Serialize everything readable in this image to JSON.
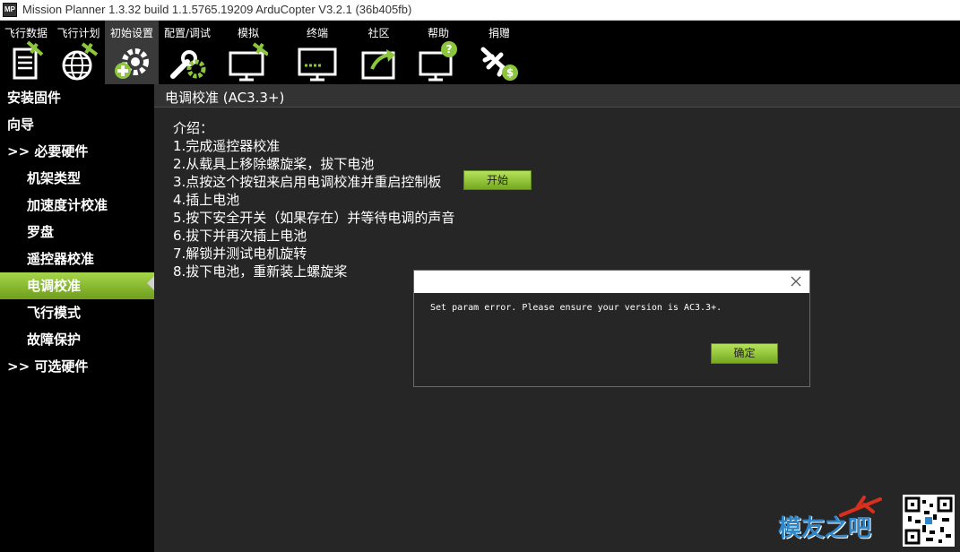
{
  "window": {
    "title": "Mission Planner 1.3.32 build 1.1.5765.19209 ArduCopter V3.2.1 (36b405fb)",
    "logo_text": "MP"
  },
  "toolbar": {
    "items": [
      {
        "label": "飞行数据",
        "icon": "document-icon"
      },
      {
        "label": "飞行计划",
        "icon": "globe-icon"
      },
      {
        "label": "初始设置",
        "icon": "gear-plus-icon"
      },
      {
        "label": "配置/调试",
        "icon": "wrench-gear-icon"
      },
      {
        "label": "模拟",
        "icon": "monitor-plane-icon"
      },
      {
        "label": "终端",
        "icon": "terminal-monitor-icon"
      },
      {
        "label": "社区",
        "icon": "share-arrow-icon"
      },
      {
        "label": "帮助",
        "icon": "help-monitor-icon"
      },
      {
        "label": "捐赠",
        "icon": "plane-dollar-icon"
      }
    ],
    "active_index": 2
  },
  "sidebar": {
    "items": [
      {
        "label": "安装固件",
        "level": "top"
      },
      {
        "label": "向导",
        "level": "top"
      },
      {
        "label": ">> 必要硬件",
        "level": "top"
      },
      {
        "label": "机架类型",
        "level": "sub"
      },
      {
        "label": "加速度计校准",
        "level": "sub"
      },
      {
        "label": "罗盘",
        "level": "sub"
      },
      {
        "label": "遥控器校准",
        "level": "sub"
      },
      {
        "label": "电调校准",
        "level": "sub",
        "selected": true
      },
      {
        "label": "飞行模式",
        "level": "sub"
      },
      {
        "label": "故障保护",
        "level": "sub"
      },
      {
        "label": ">> 可选硬件",
        "level": "top"
      }
    ]
  },
  "main": {
    "title": "电调校准 (AC3.3+)",
    "intro": "介绍：",
    "steps": [
      "1.完成遥控器校准",
      "2.从载具上移除螺旋桨，拔下电池",
      "3.点按这个按钮来启用电调校准并重启控制板",
      "4.插上电池",
      "5.按下安全开关（如果存在）并等待电调的声音",
      "6.拔下并再次插上电池",
      "7.解锁并测试电机旋转",
      "8.拔下电池，重新装上螺旋桨"
    ],
    "start_label": "开始"
  },
  "dialog": {
    "message": "Set param error. Please ensure your version is AC3.3+.",
    "ok_label": "确定"
  },
  "watermark": {
    "text": "模友之吧"
  },
  "colors": {
    "accent_green": "#8cc63f",
    "toolbar_bg": "#000000",
    "content_bg": "#262626"
  }
}
